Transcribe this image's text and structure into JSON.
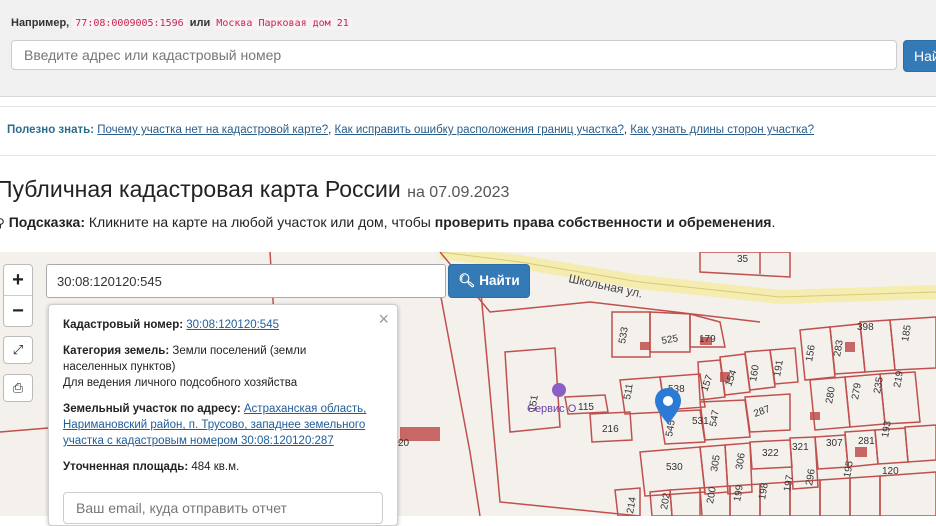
{
  "search": {
    "example_label": "Например,",
    "example_cadastral": "77:08:0009005:1596",
    "example_or": "или",
    "example_address": "Москва Парковая дом 21",
    "placeholder": "Введите адрес или кадастровый номер",
    "button_label": "Найти"
  },
  "faq": {
    "label": "Полезно знать:",
    "links": [
      "Почему участка нет на кадастровой карте?",
      "Как исправить ошибку расположения границ участка?",
      "Как узнать длины сторон участка?"
    ]
  },
  "page": {
    "title": "Публичная кадастровая карта России",
    "date": "на 07.09.2023",
    "hint_label": "Подсказка:",
    "hint_text": "Кликните на карте на любой участок или дом, чтобы",
    "hint_bold": "проверить права собственности и обременения",
    "hint_end": "."
  },
  "map": {
    "cadastral_input_value": "30:08:120120:545",
    "find_button": "Найти",
    "zoom_in": "+",
    "zoom_out": "−",
    "street_label": "Школьная ул.",
    "service_label": "Сервис О",
    "parcel_labels": [
      "35",
      "533",
      "525",
      "179",
      "511",
      "538",
      "157",
      "154",
      "160",
      "191",
      "156",
      "283",
      "398",
      "185",
      "216",
      "545",
      "531",
      "547",
      "287",
      "115",
      "151",
      "280",
      "279",
      "235",
      "219",
      "530",
      "305",
      "306",
      "322",
      "307",
      "281",
      "193",
      "195",
      "120",
      "200",
      "199",
      "198",
      "197",
      "296",
      "202",
      "214",
      "321",
      "20"
    ],
    "colors": {
      "map_bg": "#f4f1ed",
      "parcel_line": "#c0504d",
      "road": "#f5ecb0",
      "pin": "#2b7bd6"
    }
  },
  "popup": {
    "cad_label": "Кадастровый номер:",
    "cad_value": "30:08:120120:545",
    "category_label": "Категория земель:",
    "category_value": "Земли поселений (земли",
    "category_value2": "населенных пунктов)",
    "use_value": "Для ведения личного подсобного хозяйства",
    "address_label": "Земельный участок по адресу:",
    "address_line1": "Астраханская область,",
    "address_line2": "Наримановский район, п. Трусово, западнее земельного",
    "address_line3": "участка с кадастровым номером 30:08:120120:287",
    "area_label": "Уточненная площадь:",
    "area_value": "484 кв.м.",
    "email_placeholder": "Ваш email, куда отправить отчет",
    "close": "×"
  }
}
